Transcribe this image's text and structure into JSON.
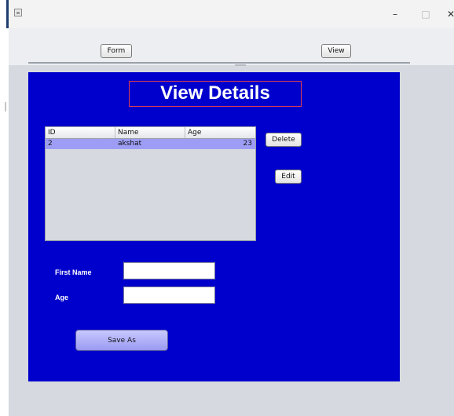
{
  "window": {
    "minimize_glyph": "–",
    "maximize_glyph": "□",
    "close_glyph": "✕"
  },
  "nav": {
    "form_label": "Form",
    "view_label": "View"
  },
  "panel": {
    "title": "View Details",
    "bg_color": "#0000cc"
  },
  "table": {
    "columns": [
      "ID",
      "Name",
      "Age"
    ],
    "rows": [
      {
        "id": "2",
        "name": "akshat",
        "age": "23"
      }
    ],
    "selected_row_color": "#9d9df5"
  },
  "actions": {
    "delete_label": "Delete",
    "edit_label": "Edit",
    "save_as_label": "Save As"
  },
  "form": {
    "first_name_label": "First Name",
    "first_name_value": "",
    "age_label": "Age",
    "age_value": ""
  },
  "icons": {
    "app": "java-app-icon"
  }
}
